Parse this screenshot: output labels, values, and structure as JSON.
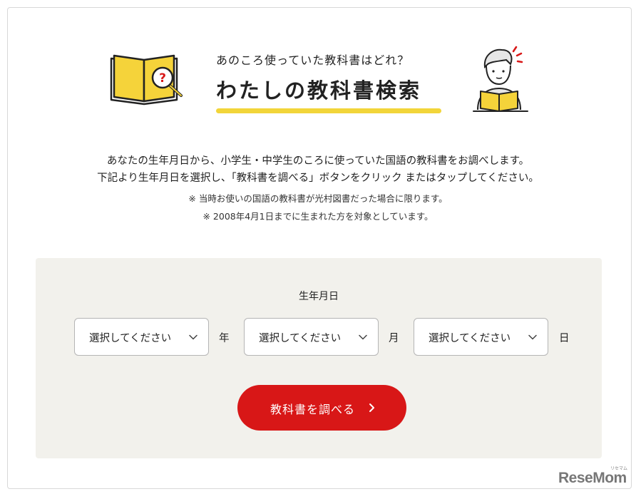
{
  "header": {
    "subtitle": "あのころ使っていた教科書はどれ？",
    "title": "わたしの教科書検索"
  },
  "description": {
    "line1": "あなたの生年月日から、小学生・中学生のころに使っていた国語の教科書をお調べします。",
    "line2": "下記より生年月日を選択し、「教科書を調べる」ボタンをクリック またはタップしてください。",
    "note1": "※ 当時お使いの国語の教科書が光村図書だった場合に限ります。",
    "note2": "※ 2008年4月1日までに生まれた方を対象としています。"
  },
  "form": {
    "birth_label": "生年月日",
    "year_select": {
      "value": "選択してください",
      "unit": "年"
    },
    "month_select": {
      "value": "選択してください",
      "unit": "月"
    },
    "day_select": {
      "value": "選択してください",
      "unit": "日"
    },
    "submit_label": "教科書を調べる"
  },
  "colors": {
    "accent_yellow": "#f2d53a",
    "button_red": "#d81717",
    "panel_bg": "#f2f1ec"
  },
  "icons": {
    "book": "open-book-with-magnifier-icon",
    "person": "person-reading-book-icon",
    "chevron": "chevron-down-icon",
    "arrow": "chevron-right-icon"
  },
  "watermark": {
    "brand": "ReseMom",
    "small": "リセマム"
  }
}
